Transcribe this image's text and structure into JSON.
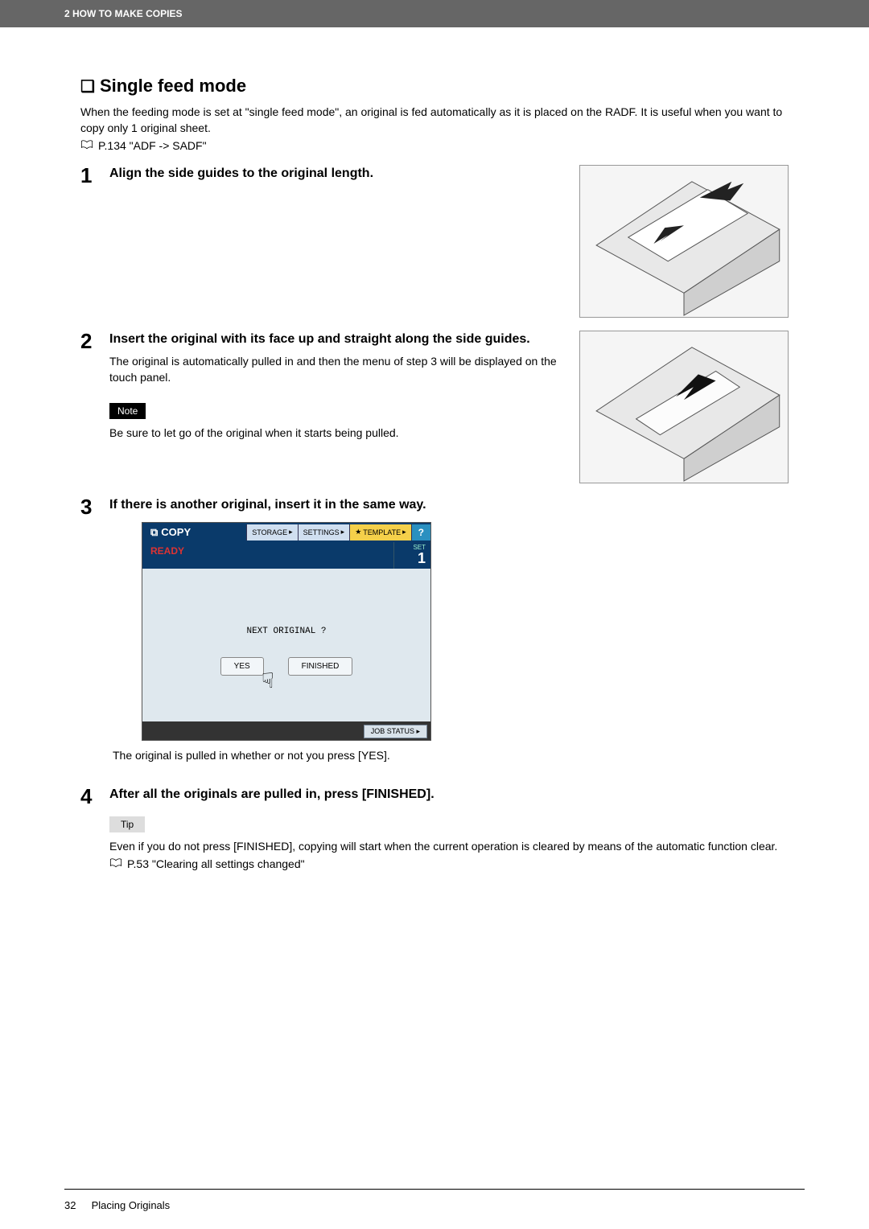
{
  "header": {
    "chapter_label": "2 HOW TO MAKE COPIES"
  },
  "section": {
    "title": "Single feed mode",
    "intro": "When the feeding mode is set at \"single feed mode\", an original is fed automatically as it is placed on the RADF. It is useful when you want to copy only 1 original sheet.",
    "ref": "P.134 \"ADF -> SADF\""
  },
  "steps": [
    {
      "num": "1",
      "title": "Align the side guides to the original length."
    },
    {
      "num": "2",
      "title": "Insert the original with its face up and straight along the side guides.",
      "desc": "The original is automatically pulled in and then the menu of step 3 will be displayed on the touch panel.",
      "note_label": "Note",
      "note_text": "Be sure to let go of the original when it starts being pulled."
    },
    {
      "num": "3",
      "title": "If there is another original, insert it in the same way.",
      "after_panel": "The original is pulled in whether or not you press [YES]."
    },
    {
      "num": "4",
      "title": "After all the originals are pulled in, press [FINISHED].",
      "tip_label": "Tip",
      "tip_text": "Even if you do not press [FINISHED], copying will start when the current operation is cleared by means of the automatic function clear.",
      "tip_ref": "P.53 \"Clearing all settings changed\""
    }
  ],
  "touch_panel": {
    "copy_label": "COPY",
    "tabs": {
      "storage": "STORAGE",
      "settings": "SETTINGS",
      "template": "TEMPLATE",
      "help": "?"
    },
    "ready": "READY",
    "set_label": "SET",
    "set_value": "1",
    "prompt": "NEXT ORIGINAL ?",
    "btn_yes": "YES",
    "btn_finished": "FINISHED",
    "job_status": "JOB STATUS"
  },
  "footer": {
    "page": "32",
    "section": "Placing Originals"
  }
}
